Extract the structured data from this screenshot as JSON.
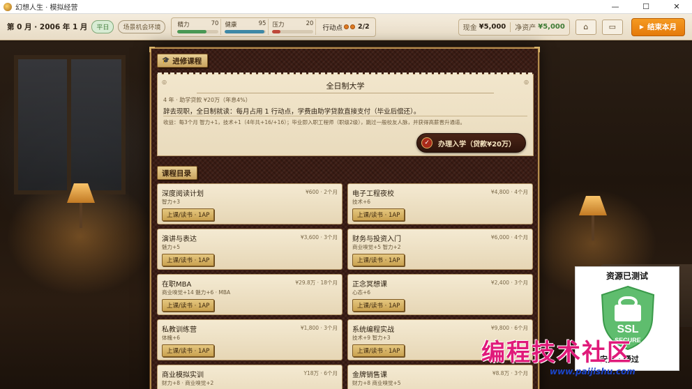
{
  "window": {
    "title": "幻想人生 · 模拟经营",
    "minimize": "—",
    "maximize": "☐",
    "close": "✕"
  },
  "hud": {
    "date": "第 0 月 · 2006 年 1 月",
    "weekday_badge": "平日",
    "event_badge": "场景机会环境",
    "stats": [
      {
        "label": "精力",
        "value": "70",
        "percent": 70,
        "color": "#4a9a55"
      },
      {
        "label": "健康",
        "value": "95",
        "percent": 95,
        "color": "#3f8aa8"
      },
      {
        "label": "压力",
        "value": "20",
        "percent": 20,
        "color": "#c0483a"
      }
    ],
    "ap_label": "行动点",
    "ap_value": "2/2",
    "cash_label": "现金",
    "cash_value": "¥5,000",
    "net_label": "净资产",
    "net_value": "¥5,000",
    "home_icon": "⌂",
    "monitor_icon": "▭",
    "end_turn_icon": "▶",
    "end_turn_label": "结束本月"
  },
  "panel": {
    "section_title": "进修课程",
    "section_icon": "🎓",
    "university": {
      "title": "全日制大学",
      "meta": "4 年 · 助学贷款 ¥20万（年息4%）",
      "description": "辞去现职，全日制就读：每月占用 1 行动点，学费由助学贷款直接支付（毕业后偿还）。",
      "effect": "收益：每3个月 智力+1，技术+1（4年共+16/+16）；毕业即入职工程师（职级2级），跳过一般校友人脉，并获得高薪晋升通道。",
      "button_label": "办理入学（贷款¥20万）",
      "button_badge": "✓"
    },
    "courses_title": "课程目录",
    "courses": [
      {
        "name": "深度阅读计划",
        "price": "¥600 · 2个月",
        "effect": "智力+3",
        "button": "上课/读书 · 1AP"
      },
      {
        "name": "电子工程夜校",
        "price": "¥4,800 · 4个月",
        "effect": "技术+6",
        "button": "上课/读书 · 1AP"
      },
      {
        "name": "演讲与表达",
        "price": "¥3,600 · 3个月",
        "effect": "魅力+5",
        "button": "上课/读书 · 1AP"
      },
      {
        "name": "财务与投资入门",
        "price": "¥6,000 · 4个月",
        "effect": "商业嗅觉+5 智力+2",
        "button": "上课/读书 · 1AP"
      },
      {
        "name": "在职MBA",
        "price": "¥29.8万 · 18个月",
        "effect": "商业嗅觉+14 魅力+6 · MBA",
        "button": "上课/读书 · 1AP"
      },
      {
        "name": "正念冥想课",
        "price": "¥2,400 · 3个月",
        "effect": "心态+6",
        "button": "上课/读书 · 1AP"
      },
      {
        "name": "私教训练营",
        "price": "¥1,800 · 3个月",
        "effect": "体魄+6",
        "button": "上课/读书 · 1AP"
      },
      {
        "name": "系统编程实战",
        "price": "¥9,800 · 6个月",
        "effect": "技术+9 智力+3",
        "button": "上课/读书 · 1AP"
      },
      {
        "name": "商业模拟实训",
        "price": "Y18万 · 6个月",
        "effect": "财力+8 · 商业嗅觉+2",
        "button": "上课/读书 · 1AP"
      },
      {
        "name": "金牌销售课",
        "price": "¥8.8万 · 3个月",
        "effect": "财力+8 商业嗅觉+5",
        "button": "上课/读书 · 1AP"
      }
    ]
  },
  "watermark": {
    "title": "资源已测试",
    "shield_line1": "SSL",
    "shield_line2": "SECURE",
    "sub": "安全 · 通过",
    "brand": "编程技术社区",
    "url": "www.paijishu.com"
  }
}
